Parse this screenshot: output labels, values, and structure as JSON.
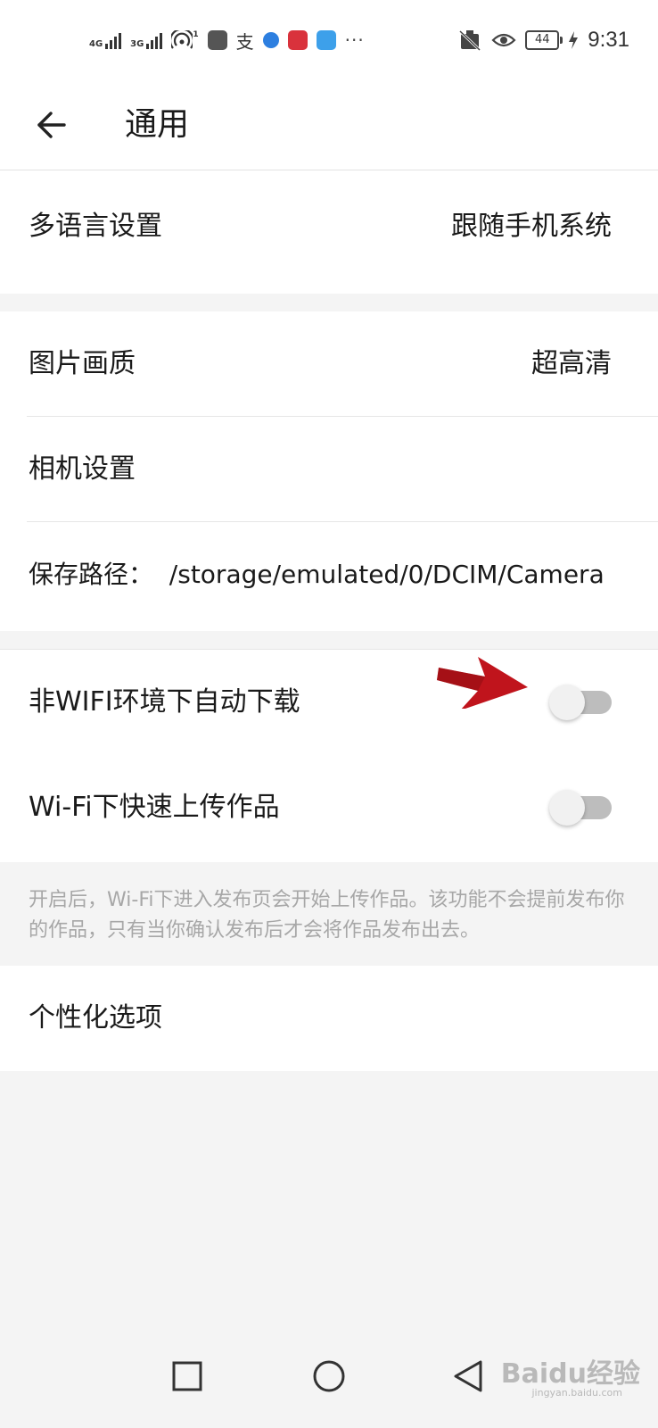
{
  "status_bar": {
    "network_1": "4G",
    "network_2": "3G",
    "hotspot_count": "1",
    "more": "···",
    "battery": "44",
    "time": "9:31",
    "icons": [
      "signal-icon",
      "hotspot-icon",
      "huawei-app-icon",
      "alipay-icon",
      "browser-icon",
      "reader-icon",
      "chat-icon",
      "no-sim-icon",
      "eye-icon",
      "charging-icon"
    ]
  },
  "header": {
    "back_icon": "arrow-left-icon",
    "title": "通用"
  },
  "settings": {
    "language": {
      "label": "多语言设置",
      "value": "跟随手机系统"
    },
    "image_quality": {
      "label": "图片画质",
      "value": "超高清"
    },
    "camera": {
      "label": "相机设置"
    },
    "save_path": {
      "label": "保存路径：  /storage/emulated/0/DCIM/Camera"
    },
    "auto_download": {
      "label": "非WIFI环境下自动下载",
      "enabled": false
    },
    "fast_upload": {
      "label": "Wi-Fi下快速上传作品",
      "enabled": false
    },
    "fast_upload_note": "开启后，Wi-Fi下进入发布页会开始上传作品。该功能不会提前发布你的作品，只有当你确认发布后才会将作品发布出去。",
    "personalization": {
      "label": "个性化选项"
    }
  },
  "annotation": {
    "icon": "red-arrow-icon",
    "color": "#c0141c"
  },
  "nav_bar": {
    "icons": [
      "square-recents-icon",
      "circle-home-icon",
      "triangle-back-icon"
    ]
  },
  "watermark": {
    "text": "Baidu经验",
    "sub": "jingyan.baidu.com"
  }
}
